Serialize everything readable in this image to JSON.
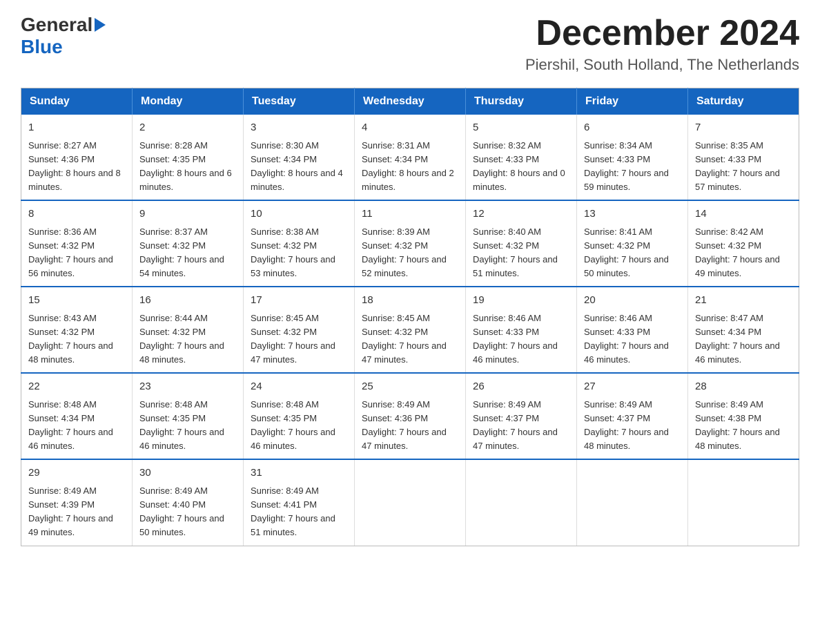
{
  "header": {
    "logo_general": "General",
    "logo_blue": "Blue",
    "month_title": "December 2024",
    "location": "Piershil, South Holland, The Netherlands"
  },
  "days_of_week": [
    "Sunday",
    "Monday",
    "Tuesday",
    "Wednesday",
    "Thursday",
    "Friday",
    "Saturday"
  ],
  "weeks": [
    [
      {
        "day": "1",
        "sunrise": "8:27 AM",
        "sunset": "4:36 PM",
        "daylight": "8 hours and 8 minutes."
      },
      {
        "day": "2",
        "sunrise": "8:28 AM",
        "sunset": "4:35 PM",
        "daylight": "8 hours and 6 minutes."
      },
      {
        "day": "3",
        "sunrise": "8:30 AM",
        "sunset": "4:34 PM",
        "daylight": "8 hours and 4 minutes."
      },
      {
        "day": "4",
        "sunrise": "8:31 AM",
        "sunset": "4:34 PM",
        "daylight": "8 hours and 2 minutes."
      },
      {
        "day": "5",
        "sunrise": "8:32 AM",
        "sunset": "4:33 PM",
        "daylight": "8 hours and 0 minutes."
      },
      {
        "day": "6",
        "sunrise": "8:34 AM",
        "sunset": "4:33 PM",
        "daylight": "7 hours and 59 minutes."
      },
      {
        "day": "7",
        "sunrise": "8:35 AM",
        "sunset": "4:33 PM",
        "daylight": "7 hours and 57 minutes."
      }
    ],
    [
      {
        "day": "8",
        "sunrise": "8:36 AM",
        "sunset": "4:32 PM",
        "daylight": "7 hours and 56 minutes."
      },
      {
        "day": "9",
        "sunrise": "8:37 AM",
        "sunset": "4:32 PM",
        "daylight": "7 hours and 54 minutes."
      },
      {
        "day": "10",
        "sunrise": "8:38 AM",
        "sunset": "4:32 PM",
        "daylight": "7 hours and 53 minutes."
      },
      {
        "day": "11",
        "sunrise": "8:39 AM",
        "sunset": "4:32 PM",
        "daylight": "7 hours and 52 minutes."
      },
      {
        "day": "12",
        "sunrise": "8:40 AM",
        "sunset": "4:32 PM",
        "daylight": "7 hours and 51 minutes."
      },
      {
        "day": "13",
        "sunrise": "8:41 AM",
        "sunset": "4:32 PM",
        "daylight": "7 hours and 50 minutes."
      },
      {
        "day": "14",
        "sunrise": "8:42 AM",
        "sunset": "4:32 PM",
        "daylight": "7 hours and 49 minutes."
      }
    ],
    [
      {
        "day": "15",
        "sunrise": "8:43 AM",
        "sunset": "4:32 PM",
        "daylight": "7 hours and 48 minutes."
      },
      {
        "day": "16",
        "sunrise": "8:44 AM",
        "sunset": "4:32 PM",
        "daylight": "7 hours and 48 minutes."
      },
      {
        "day": "17",
        "sunrise": "8:45 AM",
        "sunset": "4:32 PM",
        "daylight": "7 hours and 47 minutes."
      },
      {
        "day": "18",
        "sunrise": "8:45 AM",
        "sunset": "4:32 PM",
        "daylight": "7 hours and 47 minutes."
      },
      {
        "day": "19",
        "sunrise": "8:46 AM",
        "sunset": "4:33 PM",
        "daylight": "7 hours and 46 minutes."
      },
      {
        "day": "20",
        "sunrise": "8:46 AM",
        "sunset": "4:33 PM",
        "daylight": "7 hours and 46 minutes."
      },
      {
        "day": "21",
        "sunrise": "8:47 AM",
        "sunset": "4:34 PM",
        "daylight": "7 hours and 46 minutes."
      }
    ],
    [
      {
        "day": "22",
        "sunrise": "8:48 AM",
        "sunset": "4:34 PM",
        "daylight": "7 hours and 46 minutes."
      },
      {
        "day": "23",
        "sunrise": "8:48 AM",
        "sunset": "4:35 PM",
        "daylight": "7 hours and 46 minutes."
      },
      {
        "day": "24",
        "sunrise": "8:48 AM",
        "sunset": "4:35 PM",
        "daylight": "7 hours and 46 minutes."
      },
      {
        "day": "25",
        "sunrise": "8:49 AM",
        "sunset": "4:36 PM",
        "daylight": "7 hours and 47 minutes."
      },
      {
        "day": "26",
        "sunrise": "8:49 AM",
        "sunset": "4:37 PM",
        "daylight": "7 hours and 47 minutes."
      },
      {
        "day": "27",
        "sunrise": "8:49 AM",
        "sunset": "4:37 PM",
        "daylight": "7 hours and 48 minutes."
      },
      {
        "day": "28",
        "sunrise": "8:49 AM",
        "sunset": "4:38 PM",
        "daylight": "7 hours and 48 minutes."
      }
    ],
    [
      {
        "day": "29",
        "sunrise": "8:49 AM",
        "sunset": "4:39 PM",
        "daylight": "7 hours and 49 minutes."
      },
      {
        "day": "30",
        "sunrise": "8:49 AM",
        "sunset": "4:40 PM",
        "daylight": "7 hours and 50 minutes."
      },
      {
        "day": "31",
        "sunrise": "8:49 AM",
        "sunset": "4:41 PM",
        "daylight": "7 hours and 51 minutes."
      },
      null,
      null,
      null,
      null
    ]
  ],
  "labels": {
    "sunrise": "Sunrise:",
    "sunset": "Sunset:",
    "daylight": "Daylight:"
  }
}
